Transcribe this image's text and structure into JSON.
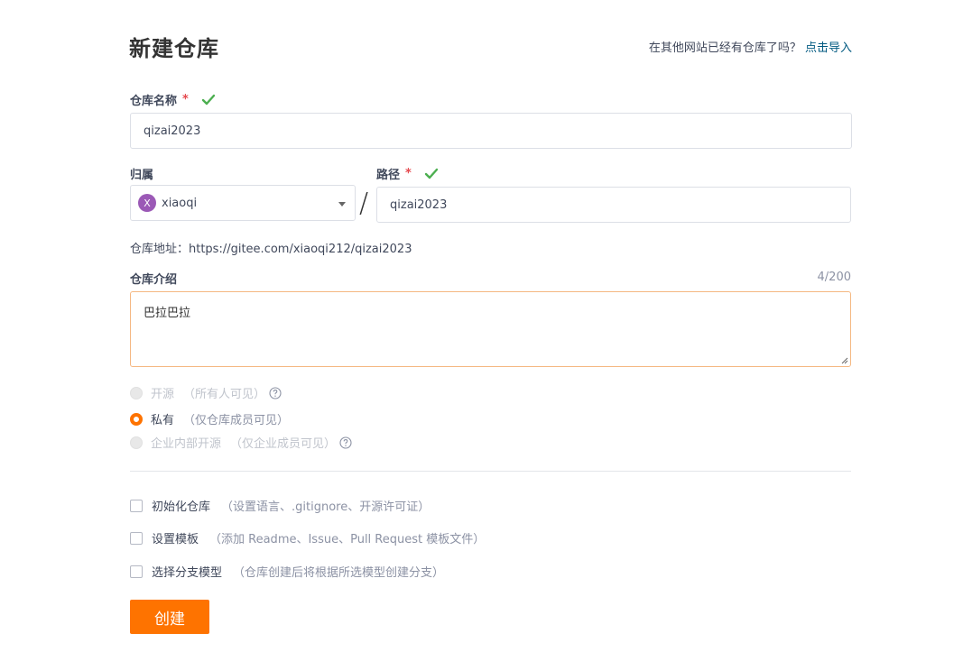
{
  "header": {
    "title": "新建仓库",
    "import_prompt": "在其他网站已经有仓库了吗？",
    "import_link": "点击导入"
  },
  "repo_name": {
    "label": "仓库名称",
    "required_mark": "*",
    "value": "qizai2023"
  },
  "owner": {
    "label": "归属",
    "avatar_letter": "X",
    "value": "xiaoqi"
  },
  "separator": "/",
  "path": {
    "label": "路径",
    "required_mark": "*",
    "value": "qizai2023"
  },
  "address": {
    "text": "仓库地址：https://gitee.com/xiaoqi212/qizai2023"
  },
  "description": {
    "label": "仓库介绍",
    "counter": "4/200",
    "value": "巴拉巴拉"
  },
  "visibility": {
    "options": [
      {
        "label": "开源",
        "hint": "（所有人可见）",
        "state": "disabled",
        "selected": false
      },
      {
        "label": "私有",
        "hint": "（仅仓库成员可见）",
        "state": "enabled",
        "selected": true
      },
      {
        "label": "企业内部开源",
        "hint": "（仅企业成员可见）",
        "state": "disabled",
        "selected": false
      }
    ]
  },
  "options": [
    {
      "label": "初始化仓库",
      "hint": "（设置语言、.gitignore、开源许可证）",
      "checked": false
    },
    {
      "label": "设置模板",
      "hint": "（添加 Readme、Issue、Pull Request 模板文件）",
      "checked": false
    },
    {
      "label": "选择分支模型",
      "hint": "（仓库创建后将根据所选模型创建分支）",
      "checked": false
    }
  ],
  "submit": {
    "label": "创建"
  },
  "colors": {
    "accent": "#fe7300",
    "link": "#005980",
    "valid": "#4caf50",
    "required": "#e5484d"
  }
}
